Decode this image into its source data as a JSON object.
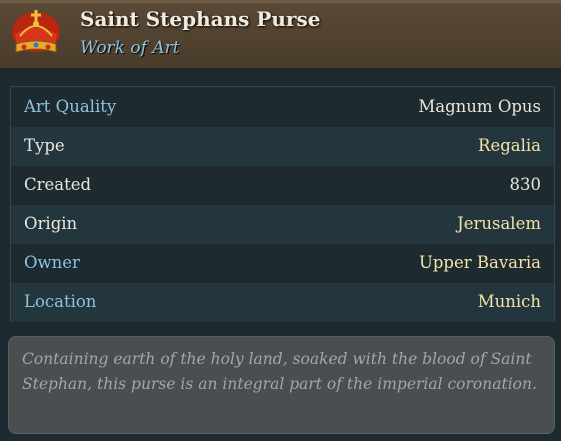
{
  "item": {
    "name": "Saint Stephans Purse",
    "category": "Work of Art",
    "icon": "crown-icon"
  },
  "stats": [
    {
      "label": "Art Quality",
      "value": "Magnum Opus"
    },
    {
      "label": "Type",
      "value": "Regalia"
    },
    {
      "label": "Created",
      "value": "830"
    },
    {
      "label": "Origin",
      "value": "Jerusalem"
    },
    {
      "label": "Owner",
      "value": "Upper Bavaria"
    },
    {
      "label": "Location",
      "value": "Munich"
    }
  ],
  "description": "Containing earth of the holy land, soaked with the blood of Saint Stephan, this purse is an integral part of the imperial coronation.",
  "colors": {
    "header": "#52432f",
    "label_blue": "#8ec3de",
    "value_gold": "#f4e2a8"
  }
}
